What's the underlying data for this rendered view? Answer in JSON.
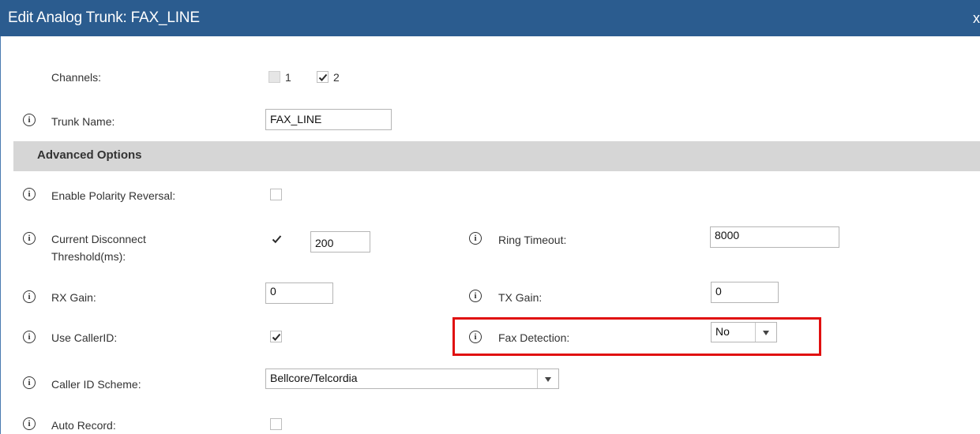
{
  "dialog": {
    "title": "Edit Analog Trunk: FAX_LINE",
    "close_label": "x"
  },
  "channels": {
    "label": "Channels:",
    "options": [
      {
        "label": "1",
        "checked": false,
        "disabled": true
      },
      {
        "label": "2",
        "checked": true,
        "disabled": false
      }
    ]
  },
  "trunk_name": {
    "label": "Trunk Name:",
    "value": "FAX_LINE"
  },
  "advanced": {
    "label": "Advanced Options"
  },
  "polarity": {
    "label": "Enable Polarity Reversal:",
    "checked": false
  },
  "current_disconnect": {
    "label_line1": "Current Disconnect",
    "label_line2": "Threshold(ms):",
    "checked": true,
    "value": "200"
  },
  "ring_timeout": {
    "label": "Ring Timeout:",
    "value": "8000"
  },
  "rx_gain": {
    "label": "RX Gain:",
    "value": "0"
  },
  "tx_gain": {
    "label": "TX Gain:",
    "value": "0"
  },
  "use_callerid": {
    "label": "Use CallerID:",
    "checked": true
  },
  "fax_detection": {
    "label": "Fax Detection:",
    "value": "No"
  },
  "caller_id_scheme": {
    "label": "Caller ID Scheme:",
    "value": "Bellcore/Telcordia"
  },
  "auto_record": {
    "label": "Auto Record:",
    "checked": false
  },
  "icons": {
    "info": "info-icon",
    "check": "checkmark-icon",
    "dropdown": "chevron-down-icon"
  },
  "colors": {
    "title_bar": "#2b5c8f",
    "section": "#d6d6d6",
    "highlight": "#e01010"
  }
}
